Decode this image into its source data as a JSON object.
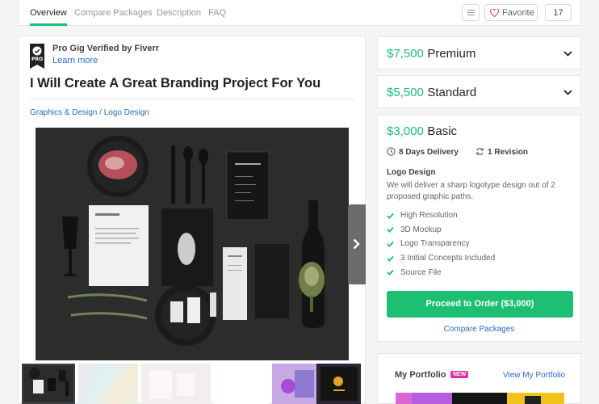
{
  "nav": {
    "tabs": [
      {
        "label": "Overview",
        "active": true
      },
      {
        "label": "Compare Packages",
        "active": false
      },
      {
        "label": "Description",
        "active": false
      },
      {
        "label": "FAQ",
        "active": false
      }
    ],
    "favorite_label": "Favorite",
    "favorite_count": "17"
  },
  "gig": {
    "badge_text": "PRO",
    "pro_label": "Pro Gig Verified by Fiverr",
    "learn_more": "Learn more",
    "title": "I Will Create A Great Branding Project For You",
    "breadcrumb": {
      "category": "Graphics & Design",
      "separator": "/",
      "subcategory": "Logo Design"
    }
  },
  "packages": {
    "premium": {
      "price": "$7,500",
      "name": "Premium"
    },
    "standard": {
      "price": "$5,500",
      "name": "Standard"
    },
    "basic": {
      "price": "$3,000",
      "name": "Basic",
      "delivery": "8 Days Delivery",
      "revisions": "1 Revision",
      "service_title": "Logo Design",
      "description": "We will deliver a sharp logotype design out of 2 proposed graphic paths.",
      "features": [
        "High Resolution",
        "3D Mockup",
        "Logo Transparency",
        "3 Initial Concepts Included",
        "Source File"
      ],
      "order_button": "Proceed to Order ($3,000)",
      "compare_link": "Compare Packages"
    }
  },
  "portfolio": {
    "title": "My Portfolio",
    "badge": "NEW",
    "view_link": "View My Portfolio"
  },
  "colors": {
    "accent": "#1dbf73",
    "link": "#2a6bc7",
    "new_badge": "#e52aa8"
  }
}
